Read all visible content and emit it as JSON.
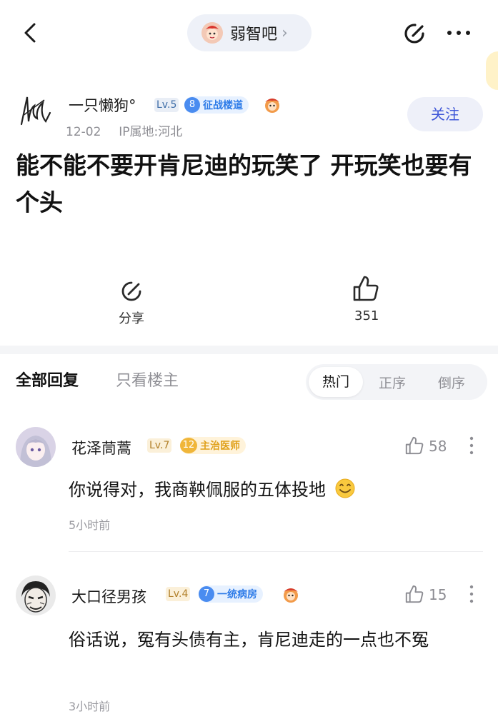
{
  "topbar": {
    "forum_name": "弱智吧",
    "chevron": "›",
    "back_icon": "chevron-left-icon",
    "edit_icon": "edit-icon",
    "more_icon": "more-dots-icon"
  },
  "post": {
    "author_name": "一只懒狗°",
    "level": "Lv.5",
    "badge_num": "8",
    "badge_title": "征战楼道",
    "date": "12-02",
    "ip_location": "IP属地:河北",
    "follow_label": "关注",
    "title": "能不能不要开肯尼迪的玩笑了 开玩笑也要有个头",
    "share_label": "分享",
    "like_count": "351"
  },
  "reply_tabs": {
    "all": "全部回复",
    "op_only": "只看楼主",
    "sort_hot": "热门",
    "sort_asc": "正序",
    "sort_desc": "倒序"
  },
  "comments": [
    {
      "name": "花泽茼蒿",
      "level": "Lv.7",
      "badge_num": "12",
      "badge_title": "主治医师",
      "likes": "58",
      "text": "你说得对，我商鞅佩服的五体投地",
      "emoji": "smile-emoji",
      "time": "5小时前"
    },
    {
      "name": "大口径男孩",
      "level": "Lv.4",
      "badge_num": "7",
      "badge_title": "一统病房",
      "likes": "15",
      "text": "俗话说，冤有头债有主，肯尼迪走的一点也不冤",
      "time": "3小时前"
    }
  ],
  "colors": {
    "accent": "#3f57d8",
    "badge_blue": "#2d7be8",
    "badge_gold": "#e0a11c",
    "muted": "#8d8d93"
  }
}
